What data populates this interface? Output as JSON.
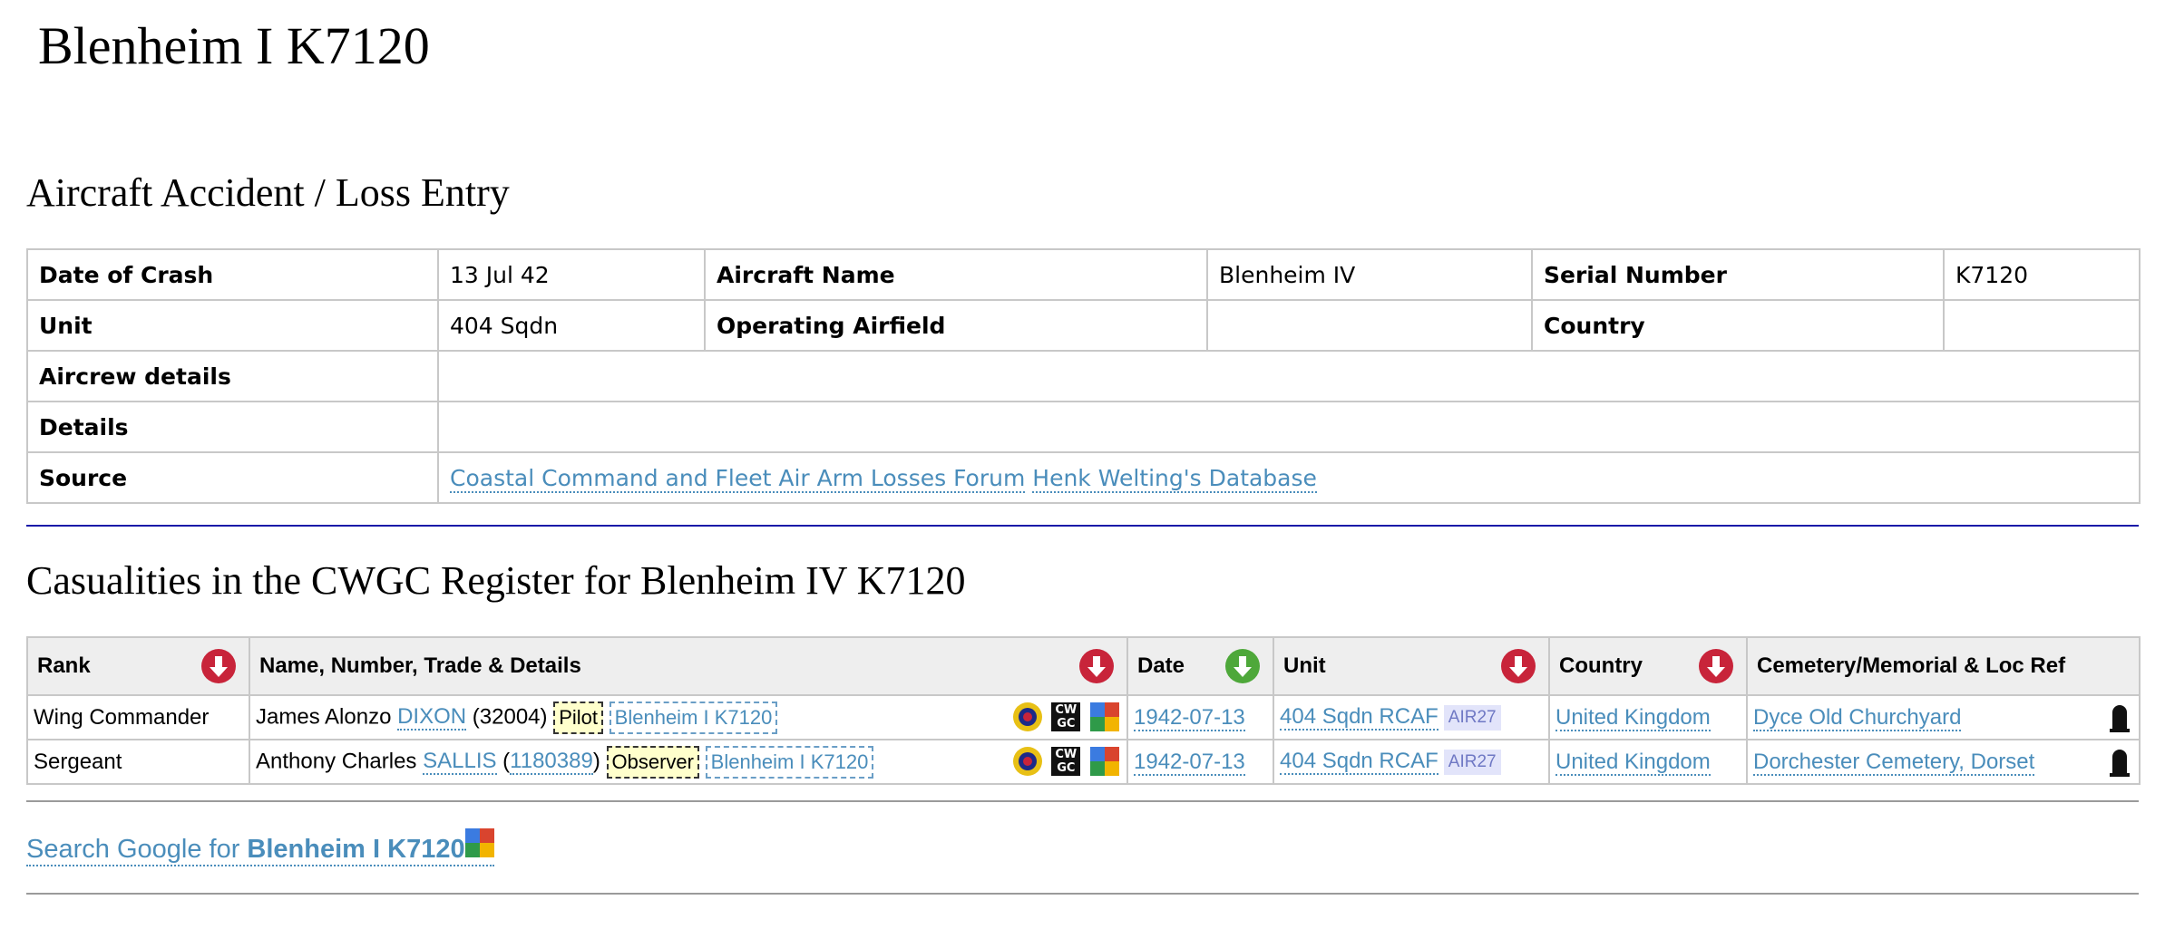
{
  "page_title": "Blenheim I  K7120",
  "accident_heading": "Aircraft Accident / Loss Entry",
  "accident": {
    "date_label": "Date of Crash",
    "date": "13 Jul 42",
    "aircraft_label": "Aircraft Name",
    "aircraft": "Blenheim IV",
    "serial_label": "Serial Number",
    "serial": "K7120",
    "unit_label": "Unit",
    "unit": "404 Sqdn",
    "airfield_label": "Operating Airfield",
    "airfield": "",
    "country_label": "Country",
    "country": "",
    "aircrew_label": "Aircrew details",
    "aircrew": "",
    "details_label": "Details",
    "details": "",
    "source_label": "Source",
    "sources": [
      "Coastal Command and Fleet Air Arm Losses Forum",
      "Henk Welting's Database"
    ]
  },
  "casualties_heading": "Casualities in the CWGC Register for Blenheim IV K7120",
  "columns": {
    "rank": "Rank",
    "name": "Name, Number, Trade & Details",
    "date": "Date",
    "unit": "Unit",
    "country": "Country",
    "cemetery": "Cemetery/Memorial & Loc Ref"
  },
  "rows": [
    {
      "rank": "Wing Commander",
      "forenames": "James Alonzo",
      "surname": "DIXON",
      "number_open": "(",
      "number": "32004",
      "number_close": ")",
      "trade": "Pilot",
      "aircraft": "Blenheim I K7120",
      "date": "1942-07-13",
      "unit": "404 Sqdn RCAF",
      "air_ref": "AIR27",
      "country": "United Kingdom",
      "cemetery": "Dyce Old Churchyard"
    },
    {
      "rank": "Sergeant",
      "forenames": "Anthony Charles",
      "surname": "SALLIS",
      "number_open": "(",
      "number": "1180389",
      "number_close": ")",
      "trade": "Observer",
      "aircraft": "Blenheim I K7120",
      "date": "1942-07-13",
      "unit": "404 Sqdn RCAF",
      "air_ref": "AIR27",
      "country": "United Kingdom",
      "cemetery": "Dorchester Cemetery, Dorset"
    }
  ],
  "icons": {
    "cwgc_text_top": "CW",
    "cwgc_text_bottom": "GC"
  },
  "search": {
    "prefix": "Search Google for ",
    "query": "Blenheim I  K7120"
  },
  "colors": {
    "link": "#4a8dbb",
    "sort_desc": "#c8243a",
    "sort_asc": "#4ea83a",
    "trade_bg": "#ffffcc",
    "air_ref_bg": "#e2e4fa"
  }
}
